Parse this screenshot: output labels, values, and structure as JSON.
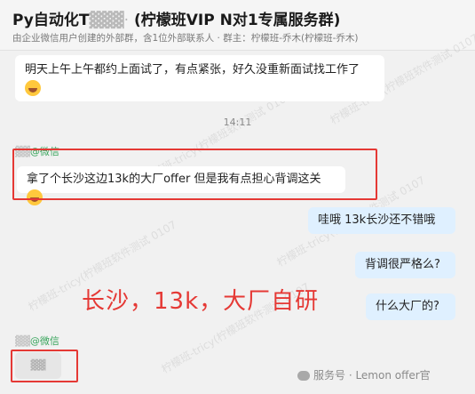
{
  "header": {
    "title_prefix": "Py自动化T",
    "title_blur": "▓▓▓·",
    "title_main": "(柠檬班VIP N对1专属服务群)",
    "subtitle": "由企业微信用户创建的外部群，含1位外部联系人 · 群主：柠檬班-乔木(柠檬班-乔木)"
  },
  "messages": {
    "msg1": "明天上午上午都约上面试了，有点紧张，好久没重新面试找工作了",
    "time": "14:11",
    "sender1_name": "▓▓",
    "sender1_suffix": "@微信",
    "msg2": "拿了个长沙这边13k的大厂offer  但是我有点担心背调这关",
    "msg3": "哇哦  13k长沙还不错哦",
    "msg4": "背调很严格么?",
    "msg5": "什么大厂的?",
    "sender2_name": "▓▓",
    "sender2_suffix": "@微信",
    "msg6_blur": "▓▓"
  },
  "annotation": "长沙，13k，大厂自研",
  "footer": "服务号 · Lemon offer官",
  "watermark": "柠檬班-tricy(柠檬班软件测试 0107",
  "colors": {
    "annotation": "#e53935",
    "wechat_green": "#3aa55d",
    "outgoing_bubble": "#dff0ff"
  }
}
